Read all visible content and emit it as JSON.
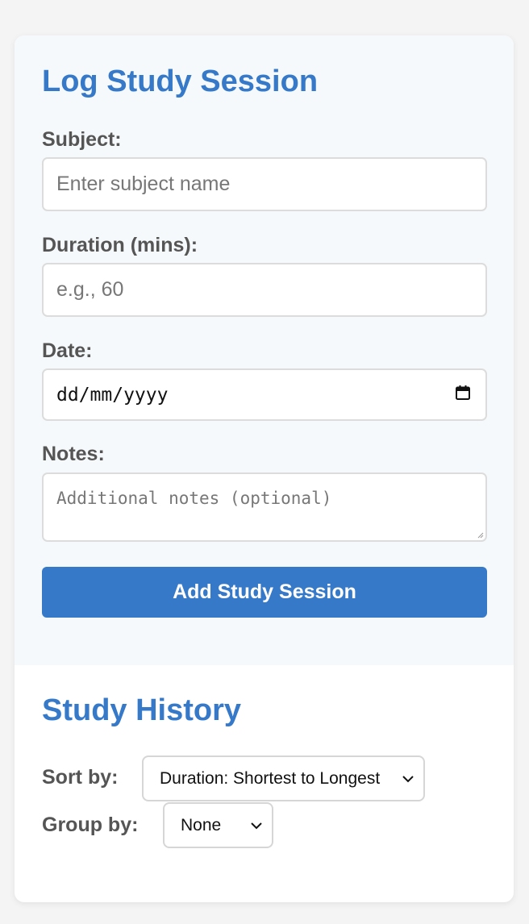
{
  "form": {
    "title": "Log Study Session",
    "subject": {
      "label": "Subject:",
      "placeholder": "Enter subject name"
    },
    "duration": {
      "label": "Duration (mins):",
      "placeholder": "e.g., 60"
    },
    "date": {
      "label": "Date:",
      "placeholder": "dd/mm/yyyy",
      "icon": "calendar-icon"
    },
    "notes": {
      "label": "Notes:",
      "placeholder": "Additional notes (optional)"
    },
    "submit_label": "Add Study Session"
  },
  "history": {
    "title": "Study History",
    "sort": {
      "label": "Sort by:",
      "selected": "Duration: Shortest to Longest"
    },
    "group": {
      "label": "Group by:",
      "selected": "None"
    }
  },
  "colors": {
    "accent": "#3579c8",
    "label": "#555555",
    "form_bg": "#f6f9fb",
    "page_bg": "#f4f4f4"
  }
}
